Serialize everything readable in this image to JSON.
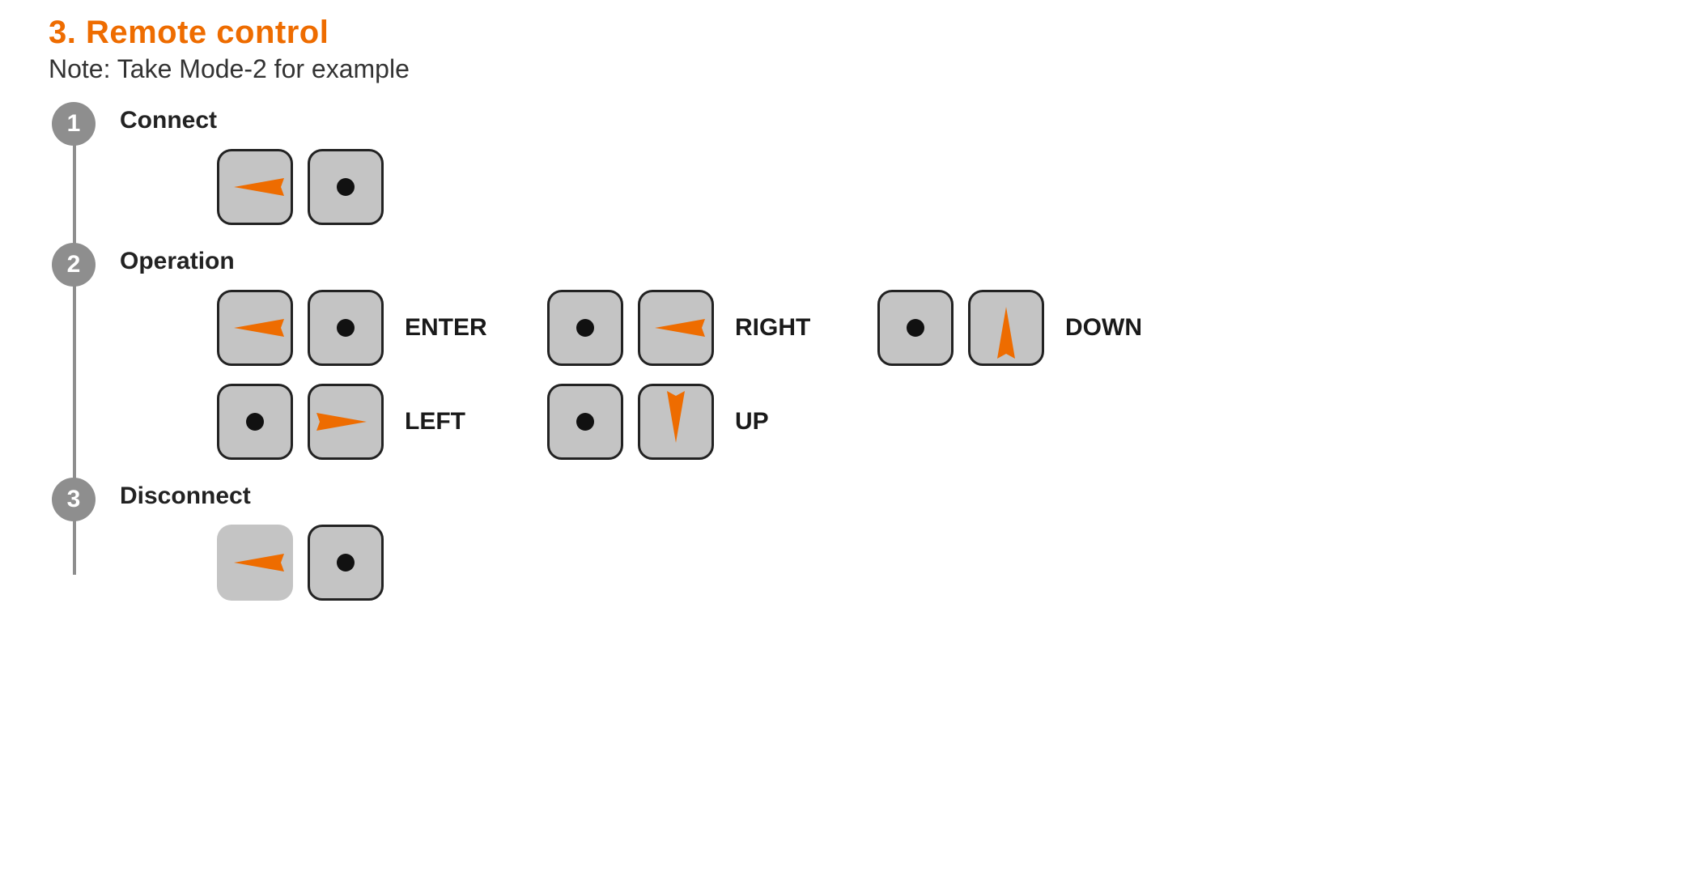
{
  "heading": "3. Remote control",
  "note": "Note: Take Mode-2 for example",
  "accent_color": "#ee6c00",
  "badge_color": "#8e8e8e",
  "steps": {
    "s1": {
      "num": "1",
      "title": "Connect"
    },
    "s2": {
      "num": "2",
      "title": "Operation",
      "labels": {
        "enter": "ENTER",
        "left": "LEFT",
        "right": "RIGHT",
        "up": "UP",
        "down": "DOWN"
      }
    },
    "s3": {
      "num": "3",
      "title": "Disconnect"
    }
  },
  "stick_actions": {
    "connect": {
      "left_stick": "left",
      "right_stick": "center"
    },
    "enter": {
      "left_stick": "left",
      "right_stick": "center"
    },
    "left": {
      "left_stick": "center",
      "right_stick": "right"
    },
    "right": {
      "left_stick": "center",
      "right_stick": "left"
    },
    "up": {
      "left_stick": "center",
      "right_stick": "down"
    },
    "down": {
      "left_stick": "center",
      "right_stick": "up"
    },
    "disconnect": {
      "left_stick": "left",
      "right_stick": "center"
    }
  }
}
